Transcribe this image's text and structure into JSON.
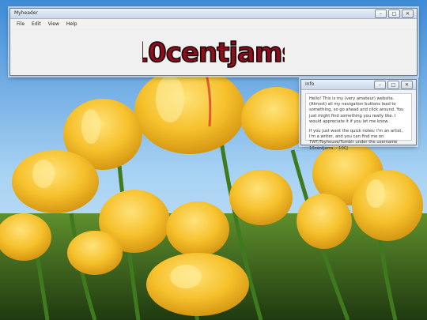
{
  "main_window": {
    "title": "Myheader",
    "menu": [
      "File",
      "Edit",
      "View",
      "Help"
    ],
    "logo_text": "10centjams"
  },
  "info_window": {
    "title": "Info",
    "paragraph1": "Hello! This is my (very amateur) website. (Almost) all my navigation buttons lead to something, so go ahead and click around. You just might find something you really like. I would appreciate it if you let me know.",
    "paragraph2": "If you just want the quick notes: I'm an artist, I'm a writer, and you can find me on TWT/Toyhouse/Tumblr under the username 10centjams. - 10CJ"
  },
  "window_controls": [
    "minimize-icon",
    "maximize-icon",
    "close-icon"
  ]
}
